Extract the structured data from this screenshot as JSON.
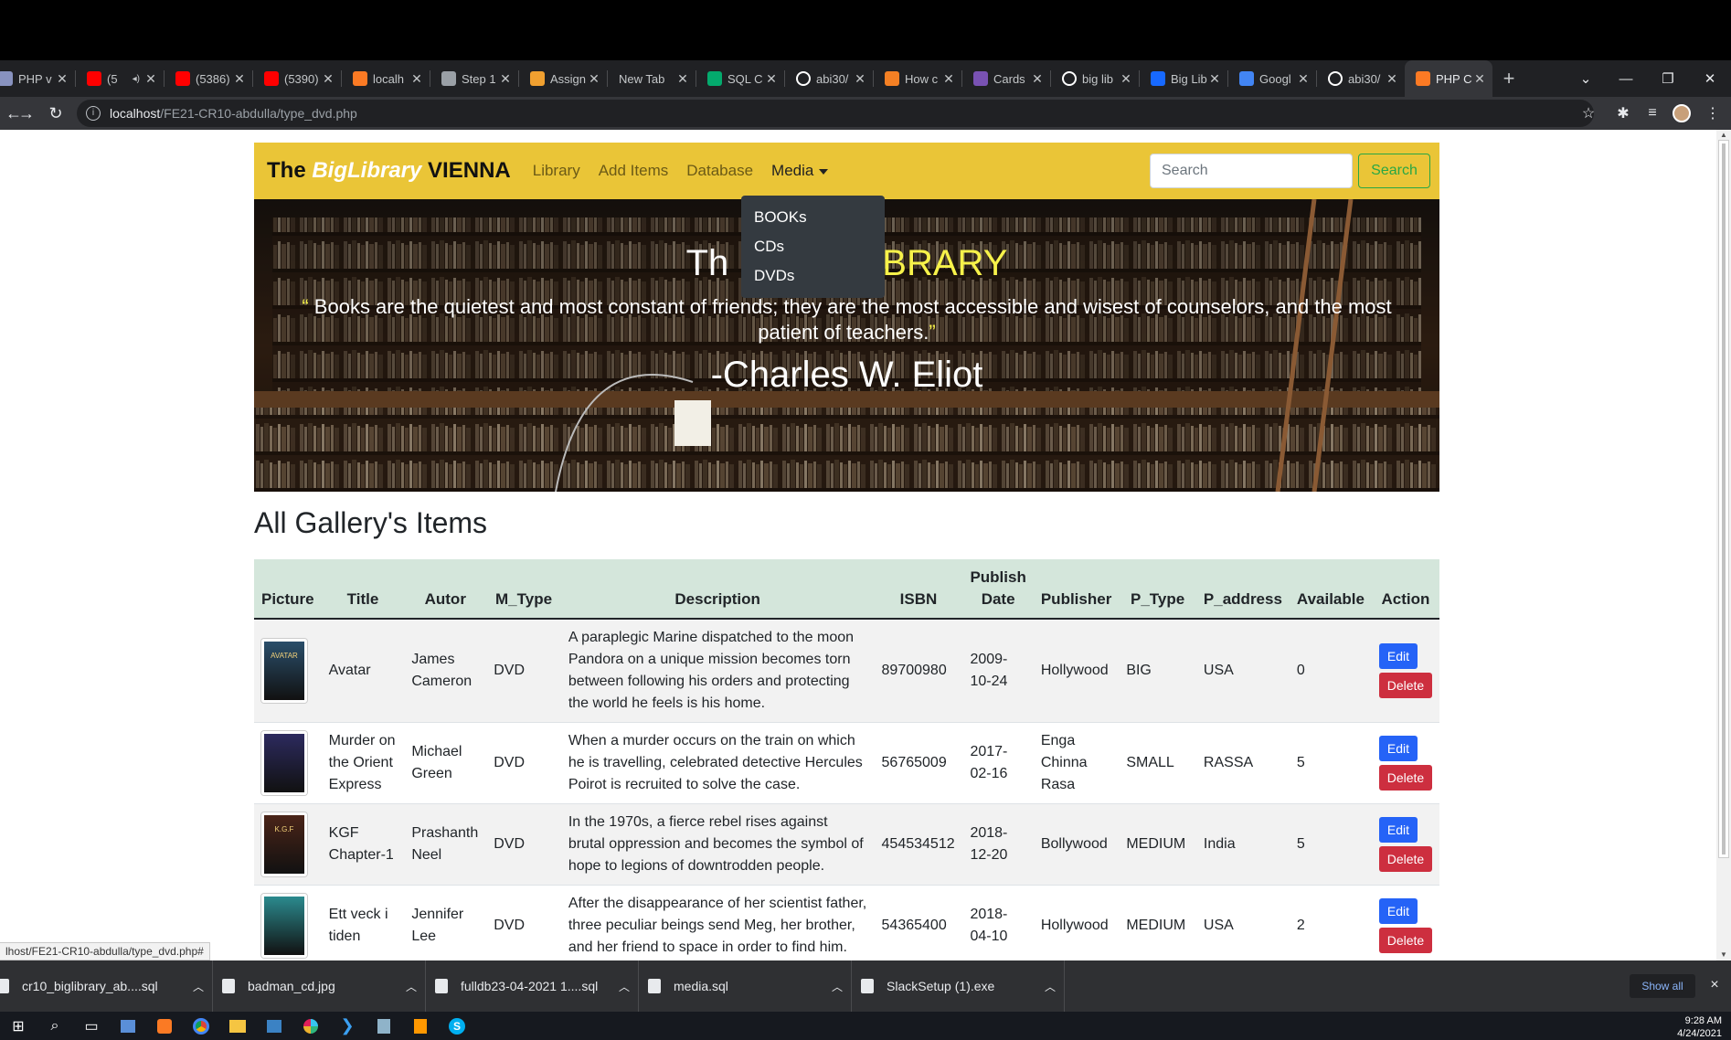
{
  "browser": {
    "tabs": [
      {
        "title": "PHP v",
        "icon": "php-icon",
        "color": "#8892bf"
      },
      {
        "title": "(5",
        "icon": "youtube-icon",
        "color": "#ff0000",
        "audio": true
      },
      {
        "title": "(5386)",
        "icon": "youtube-icon",
        "color": "#ff0000"
      },
      {
        "title": "(5390)",
        "icon": "youtube-icon",
        "color": "#ff0000"
      },
      {
        "title": "localh",
        "icon": "xampp-icon",
        "color": "#fb7a24"
      },
      {
        "title": "Step 1",
        "icon": "globe-icon",
        "color": "#9aa0a6"
      },
      {
        "title": "Assign",
        "icon": "codefactory-icon",
        "color": "#f0a030"
      },
      {
        "title": "New Tab",
        "icon": "",
        "color": ""
      },
      {
        "title": "SQL C",
        "icon": "w3schools-icon",
        "color": "#04aa6d"
      },
      {
        "title": "abi30/",
        "icon": "github-icon",
        "color": "#ffffff"
      },
      {
        "title": "How c",
        "icon": "stackoverflow-icon",
        "color": "#f48024"
      },
      {
        "title": "Cards",
        "icon": "bootstrap-icon",
        "color": "#7952b3"
      },
      {
        "title": "big lib",
        "icon": "google-icon",
        "color": "#ffffff"
      },
      {
        "title": "Big Lib",
        "icon": "behance-icon",
        "color": "#1769ff"
      },
      {
        "title": "Googl",
        "icon": "translate-icon",
        "color": "#4285f4"
      },
      {
        "title": "abi30/",
        "icon": "github-icon",
        "color": "#ffffff"
      },
      {
        "title": "PHP C",
        "icon": "xampp-icon",
        "color": "#fb7a24",
        "active": true
      }
    ],
    "new_tab": "+",
    "url_host": "localhost",
    "url_path": "/FE21-CR10-abdulla/type_dvd.php",
    "status_url": "lhost/FE21-CR10-abdulla/type_dvd.php#"
  },
  "site": {
    "brand_prefix": "The",
    "brand_italic": "BigLibrary",
    "brand_suffix": "VIENNA",
    "nav": {
      "library": "Library",
      "add_items": "Add Items",
      "database": "Database",
      "media": "Media"
    },
    "dropdown": [
      "BOOKs",
      "CDs",
      "DVDs"
    ],
    "search_placeholder": "Search",
    "search_button": "Search",
    "hero": {
      "title_white": "Th",
      "title_yellow": "BRARY",
      "quote_open": "“",
      "quote": "Books are the quietest and most constant of friends; they are the most accessible and wisest of counselors, and the most patient of teachers.",
      "quote_close": "”",
      "author": "-Charles W. Eliot"
    },
    "heading": "All Gallery's Items",
    "table": {
      "columns": [
        "Picture",
        "Title",
        "Autor",
        "M_Type",
        "Description",
        "ISBN",
        "Publish Date",
        "Publisher",
        "P_Type",
        "P_address",
        "Available",
        "Action"
      ],
      "edit_label": "Edit",
      "delete_label": "Delete",
      "rows": [
        {
          "title": "Avatar",
          "autor": "James Cameron",
          "m_type": "DVD",
          "description": "A paraplegic Marine dispatched to the moon Pandora on a unique mission becomes torn between following his orders and protecting the world he feels is his home.",
          "isbn": "89700980",
          "date": "2009-10-24",
          "publisher": "Hollywood",
          "p_type": "BIG",
          "p_address": "USA",
          "available": "0",
          "thumb_color": "#2a4e6a",
          "thumb_text": "AVATAR"
        },
        {
          "title": "Murder on the Orient Express",
          "autor": "Michael Green",
          "m_type": "DVD",
          "description": "When a murder occurs on the train on which he is travelling, celebrated detective Hercules Poirot is recruited to solve the case.",
          "isbn": "56765009",
          "date": "2017-02-16",
          "publisher": "Enga Chinna Rasa",
          "p_type": "SMALL",
          "p_address": "RASSA",
          "available": "5",
          "thumb_color": "#2c2a5e",
          "thumb_text": ""
        },
        {
          "title": "KGF Chapter-1",
          "autor": "Prashanth Neel",
          "m_type": "DVD",
          "description": "In the 1970s, a fierce rebel rises against brutal oppression and becomes the symbol of hope to legions of downtrodden people.",
          "isbn": "454534512",
          "date": "2018-12-20",
          "publisher": "Bollywood",
          "p_type": "MEDIUM",
          "p_address": "India",
          "available": "5",
          "thumb_color": "#4a2418",
          "thumb_text": "K.G.F"
        },
        {
          "title": "Ett veck i tiden",
          "autor": "Jennifer Lee",
          "m_type": "DVD",
          "description": "After the disappearance of her scientist father, three peculiar beings send Meg, her brother, and her friend to space in order to find him.",
          "isbn": "54365400",
          "date": "2018-04-10",
          "publisher": "Hollywood",
          "p_type": "MEDIUM",
          "p_address": "USA",
          "available": "2",
          "thumb_color": "#2b8a8e",
          "thumb_text": ""
        }
      ]
    }
  },
  "downloads": {
    "items": [
      "cr10_biglibrary_ab....sql",
      "badman_cd.jpg",
      "fulldb23-04-2021 1....sql",
      "media.sql",
      "SlackSetup (1).exe"
    ],
    "show_all": "Show all",
    "close": "×"
  },
  "taskbar": {
    "time": "9:28 AM",
    "date": "4/24/2021"
  }
}
